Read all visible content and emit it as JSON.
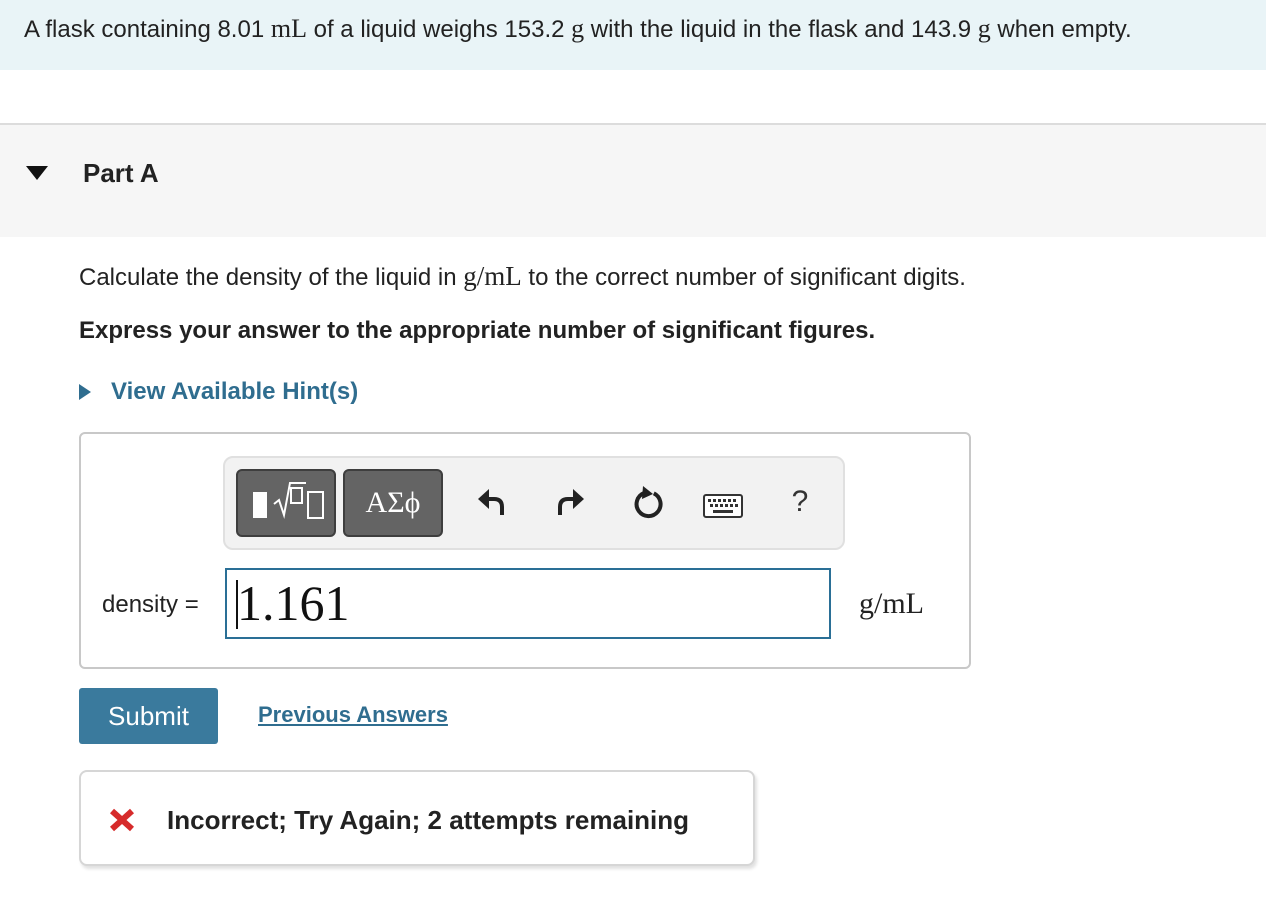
{
  "problem": {
    "text_1": "A flask containing 8.01 ",
    "volume_unit": "mL",
    "text_2": " of a liquid weighs 153.2 ",
    "mass_unit_1": "g",
    "text_3": " with the liquid in the flask and 143.9 ",
    "mass_unit_2": "g",
    "text_4": " when empty."
  },
  "part": {
    "title": "Part A",
    "question_1": "Calculate the density of the liquid in ",
    "question_unit": "g/mL",
    "question_2": " to the correct number of significant digits.",
    "instruction": "Express your answer to the appropriate number of significant figures.",
    "hints_label": "View Available Hint(s)"
  },
  "toolbar": {
    "templates_icon": "templates-sqrt-icon",
    "greek_label": "ΑΣϕ",
    "undo_icon": "undo-icon",
    "redo_icon": "redo-icon",
    "reset_icon": "reset-icon",
    "keyboard_icon": "keyboard-icon",
    "help_label": "?"
  },
  "answer": {
    "label": "density =",
    "value": "1.161",
    "units": "g/mL"
  },
  "actions": {
    "submit_label": "Submit",
    "previous_answers_label": "Previous Answers"
  },
  "feedback": {
    "icon": "x-icon",
    "text": "Incorrect; Try Again; 2 attempts remaining"
  },
  "colors": {
    "banner_bg": "#e9f4f7",
    "link": "#2f6d8f",
    "submit_bg": "#3a7a9d",
    "input_border": "#2a6f96",
    "error_red": "#d62b2b",
    "toolbar_button": "#646464"
  }
}
